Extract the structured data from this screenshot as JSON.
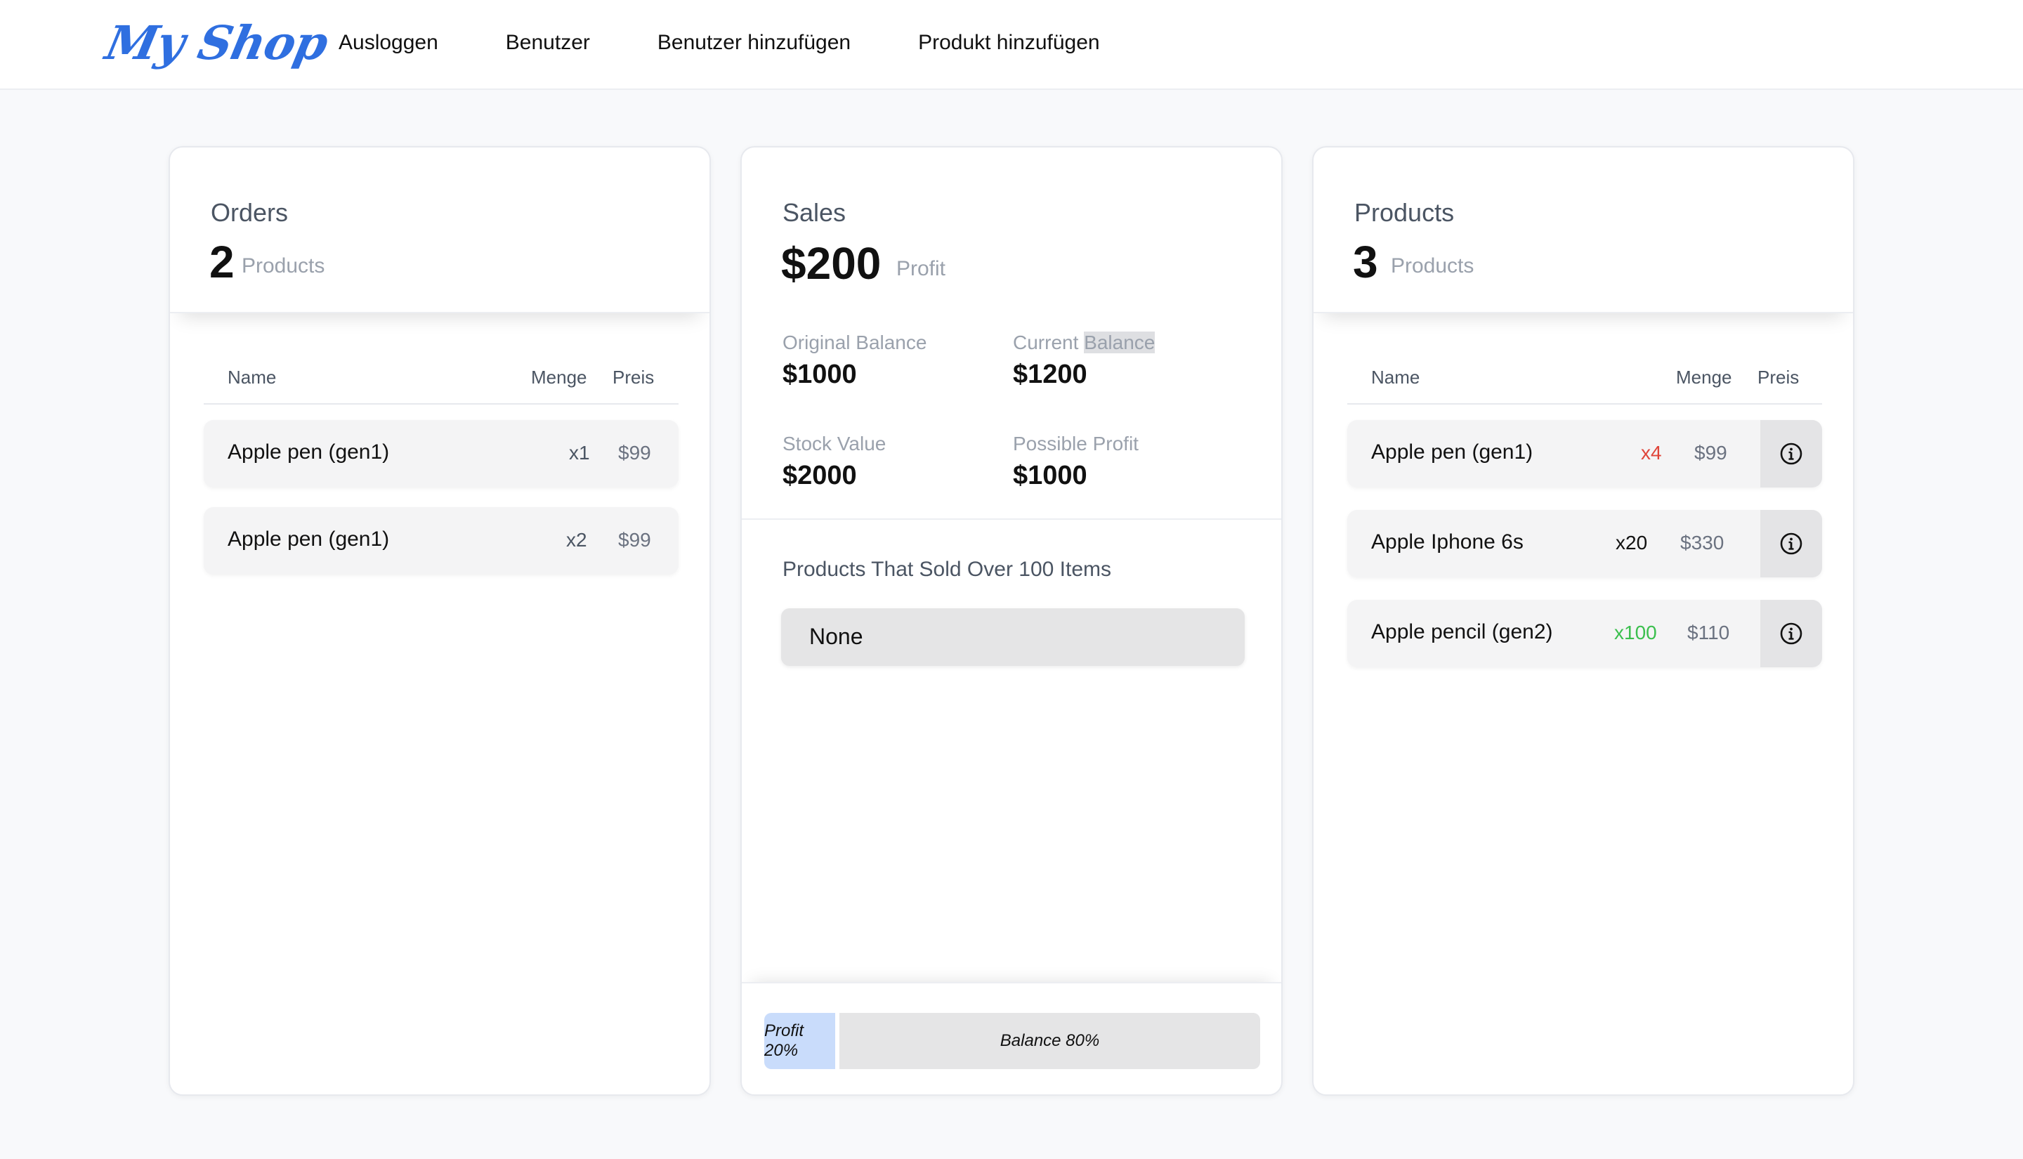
{
  "nav": {
    "logo": "My Shop",
    "links": [
      "Ausloggen",
      "Benutzer",
      "Benutzer hinzufügen",
      "Produkt hinzufügen"
    ]
  },
  "orders": {
    "title": "Orders",
    "count": "2",
    "unit": "Products",
    "columns": [
      "Name",
      "Menge",
      "Preis"
    ],
    "rows": [
      {
        "name": "Apple pen (gen1)",
        "qty": "x1",
        "price": "$99"
      },
      {
        "name": "Apple pen (gen1)",
        "qty": "x2",
        "price": "$99"
      }
    ]
  },
  "sales": {
    "title": "Sales",
    "amount": "$200",
    "unit": "Profit",
    "original_balance_label": "Original Balance",
    "original_balance": "$1000",
    "current_balance_label_a": "Current ",
    "current_balance_label_b": "Balance",
    "current_balance": "$1200",
    "stock_value_label": "Stock Value",
    "stock_value": "$2000",
    "possible_profit_label": "Possible Profit",
    "possible_profit": "$1000",
    "sold_title": "Products That Sold Over 100 Items",
    "sold_value": "None",
    "bar": {
      "profit_label": "Profit 20%",
      "balance_label": "Balance 80%",
      "profit_pct": 20,
      "balance_pct": 80,
      "profit_color": "#c9dcfb",
      "balance_color": "#e5e5e6"
    }
  },
  "products": {
    "title": "Products",
    "count": "3",
    "unit": "Products",
    "columns": [
      "Name",
      "Menge",
      "Preis"
    ],
    "rows": [
      {
        "name": "Apple pen (gen1)",
        "qty": "x4",
        "price": "$99",
        "qty_color": "#e0453a"
      },
      {
        "name": "Apple Iphone 6s",
        "qty": "x20",
        "price": "$330",
        "qty_color": "#111111"
      },
      {
        "name": "Apple pencil (gen2)",
        "qty": "x100",
        "price": "$110",
        "qty_color": "#3bbf4e"
      }
    ]
  },
  "colors": {
    "brand": "#2f6fe0",
    "background": "#f8f9fb"
  }
}
